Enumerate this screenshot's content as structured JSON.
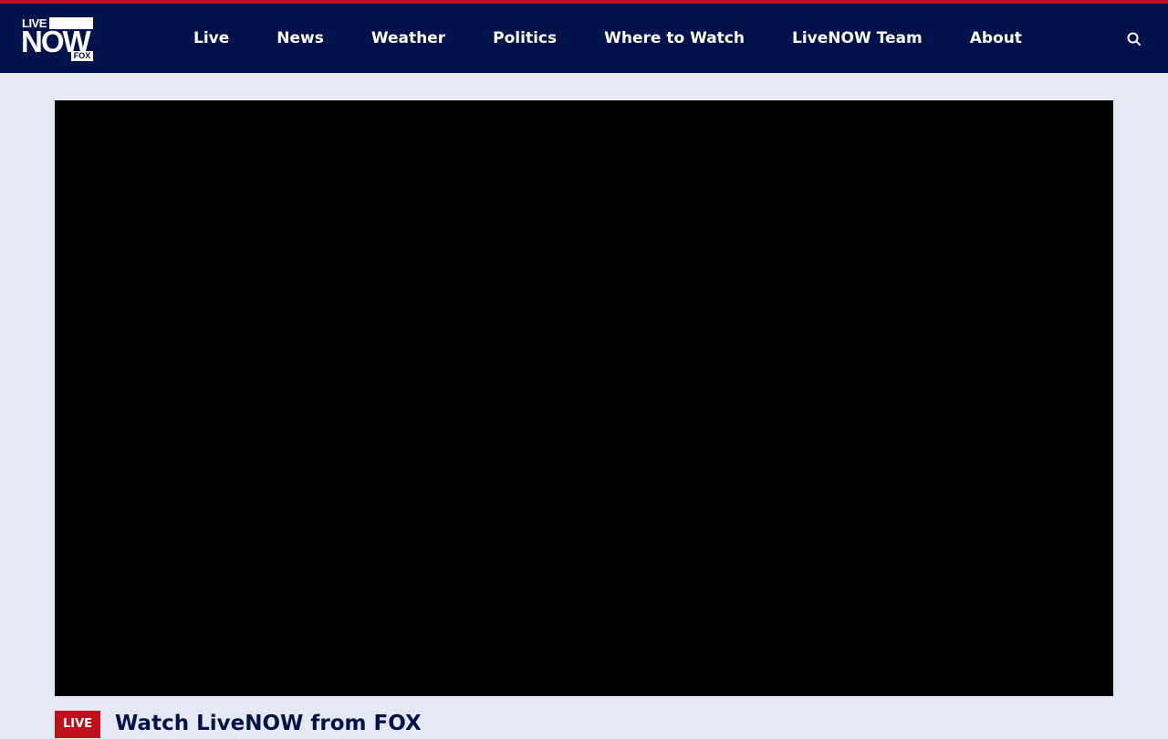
{
  "header": {
    "logo": {
      "line1": "LIVE",
      "line2": "NOW",
      "line3": "FOX"
    },
    "nav": [
      {
        "label": "Live"
      },
      {
        "label": "News"
      },
      {
        "label": "Weather"
      },
      {
        "label": "Politics"
      },
      {
        "label": "Where to Watch"
      },
      {
        "label": "LiveNOW Team"
      },
      {
        "label": "About"
      }
    ],
    "search_icon": "search-icon"
  },
  "main": {
    "live_badge": "LIVE",
    "title": "Watch LiveNOW from FOX"
  },
  "colors": {
    "accent_red": "#c00f1a",
    "header_navy": "#00124a",
    "page_background": "#e6e9f3",
    "video_background": "#000000"
  }
}
